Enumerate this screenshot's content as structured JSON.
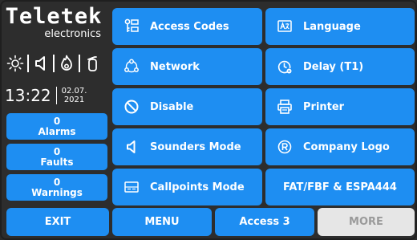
{
  "left_panel": {
    "brand": "Teletek",
    "brand_sub": "electronics",
    "status_icons": [
      "sun-icon",
      "speaker-icon",
      "flame-icon",
      "fire-extinguisher-icon"
    ],
    "time": "13:22",
    "date_day_month": "02.07.",
    "date_year": "2021",
    "alarms": {
      "count": "0",
      "label": "Alarms"
    },
    "faults": {
      "count": "0",
      "label": "Faults"
    },
    "warnings": {
      "count": "0",
      "label": "Warnings"
    }
  },
  "menu": {
    "access_codes": {
      "label": "Access Codes",
      "icon": "key-list-icon"
    },
    "language": {
      "label": "Language",
      "icon": "language-icon"
    },
    "network": {
      "label": "Network",
      "icon": "network-icon"
    },
    "delay": {
      "label": "Delay (T1)",
      "icon": "clock-icon"
    },
    "disable": {
      "label": "Disable",
      "icon": "disable-icon"
    },
    "printer": {
      "label": "Printer",
      "icon": "printer-icon"
    },
    "sounders_mode": {
      "label": "Sounders Mode",
      "icon": "speaker-icon"
    },
    "company_logo": {
      "label": "Company Logo",
      "icon": "registered-icon"
    },
    "callpoints_mode": {
      "label": "Callpoints Mode",
      "icon": "callpoint-icon"
    },
    "fat_fbf": {
      "label": "FAT/FBF & ESPA444"
    }
  },
  "bottom_bar": {
    "exit": "EXIT",
    "menu": "MENU",
    "access": "Access 3",
    "more": "MORE"
  },
  "colors": {
    "button": "#1e8ef2",
    "background": "#2d2d2d",
    "disabled_button": "#e6e6e6",
    "disabled_text": "#9a9a9a"
  }
}
